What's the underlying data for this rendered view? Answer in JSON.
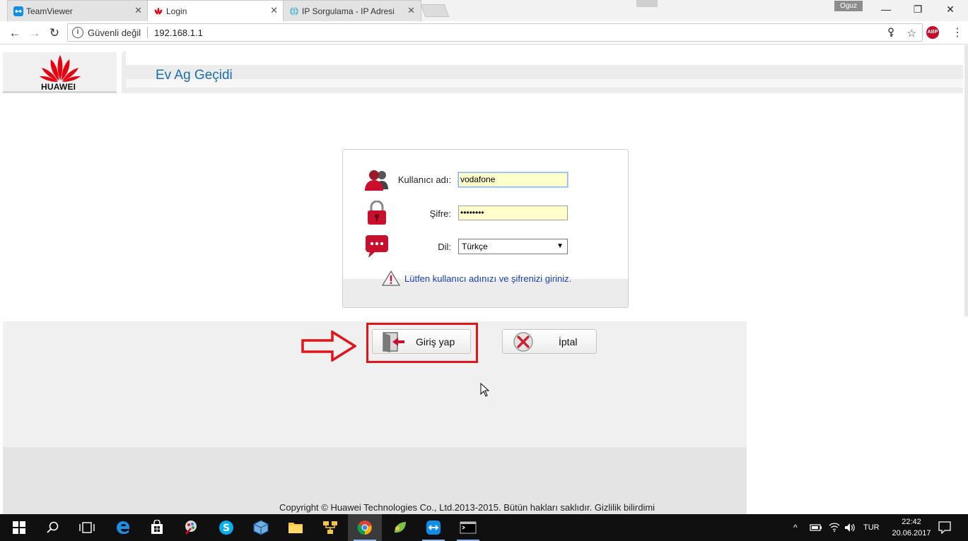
{
  "browser": {
    "tabs": [
      {
        "label": "TeamViewer",
        "close": "✕"
      },
      {
        "label": "Login",
        "close": "✕"
      },
      {
        "label": "IP Sorgulama - IP Adresi",
        "close": "✕"
      }
    ],
    "profile_name": "Oguz",
    "window_controls": {
      "minimize": "—",
      "restore": "❐",
      "close": "✕"
    },
    "nav": {
      "back": "←",
      "forward": "→",
      "reload": "↻"
    },
    "security_label": "Güvenli değil",
    "url": "192.168.1.1",
    "abp_label": "ABP",
    "star": "☆",
    "menu": "⋮"
  },
  "page": {
    "brand": "HUAWEI",
    "title": "Ev Ag Geçidi",
    "login": {
      "username_label": "Kullanıcı adı:",
      "username_value": "vodafone",
      "password_label": "Şifre:",
      "password_value": "••••••••",
      "language_label": "Dil:",
      "language_value": "Türkçe",
      "select_arrow": "▼",
      "warning": "Lütfen kullanıcı adınızı ve şifrenizi giriniz."
    },
    "buttons": {
      "login": "Giriş yap",
      "cancel": "İptal"
    },
    "copyright": "Copyright © Huawei Technologies Co., Ltd.2013-2015. Bütün hakları saklıdır. Gizlilik bilirdimi"
  },
  "taskbar": {
    "language": "TUR",
    "time": "22:42",
    "date": "20.06.2017",
    "tray_up": "^"
  },
  "colors": {
    "accent_title": "#1c6ea4",
    "warning_text": "#1a3fb0",
    "input_bg": "#ffffcc",
    "annotation_red": "#e0141b",
    "huawei_red": "#e60012"
  }
}
